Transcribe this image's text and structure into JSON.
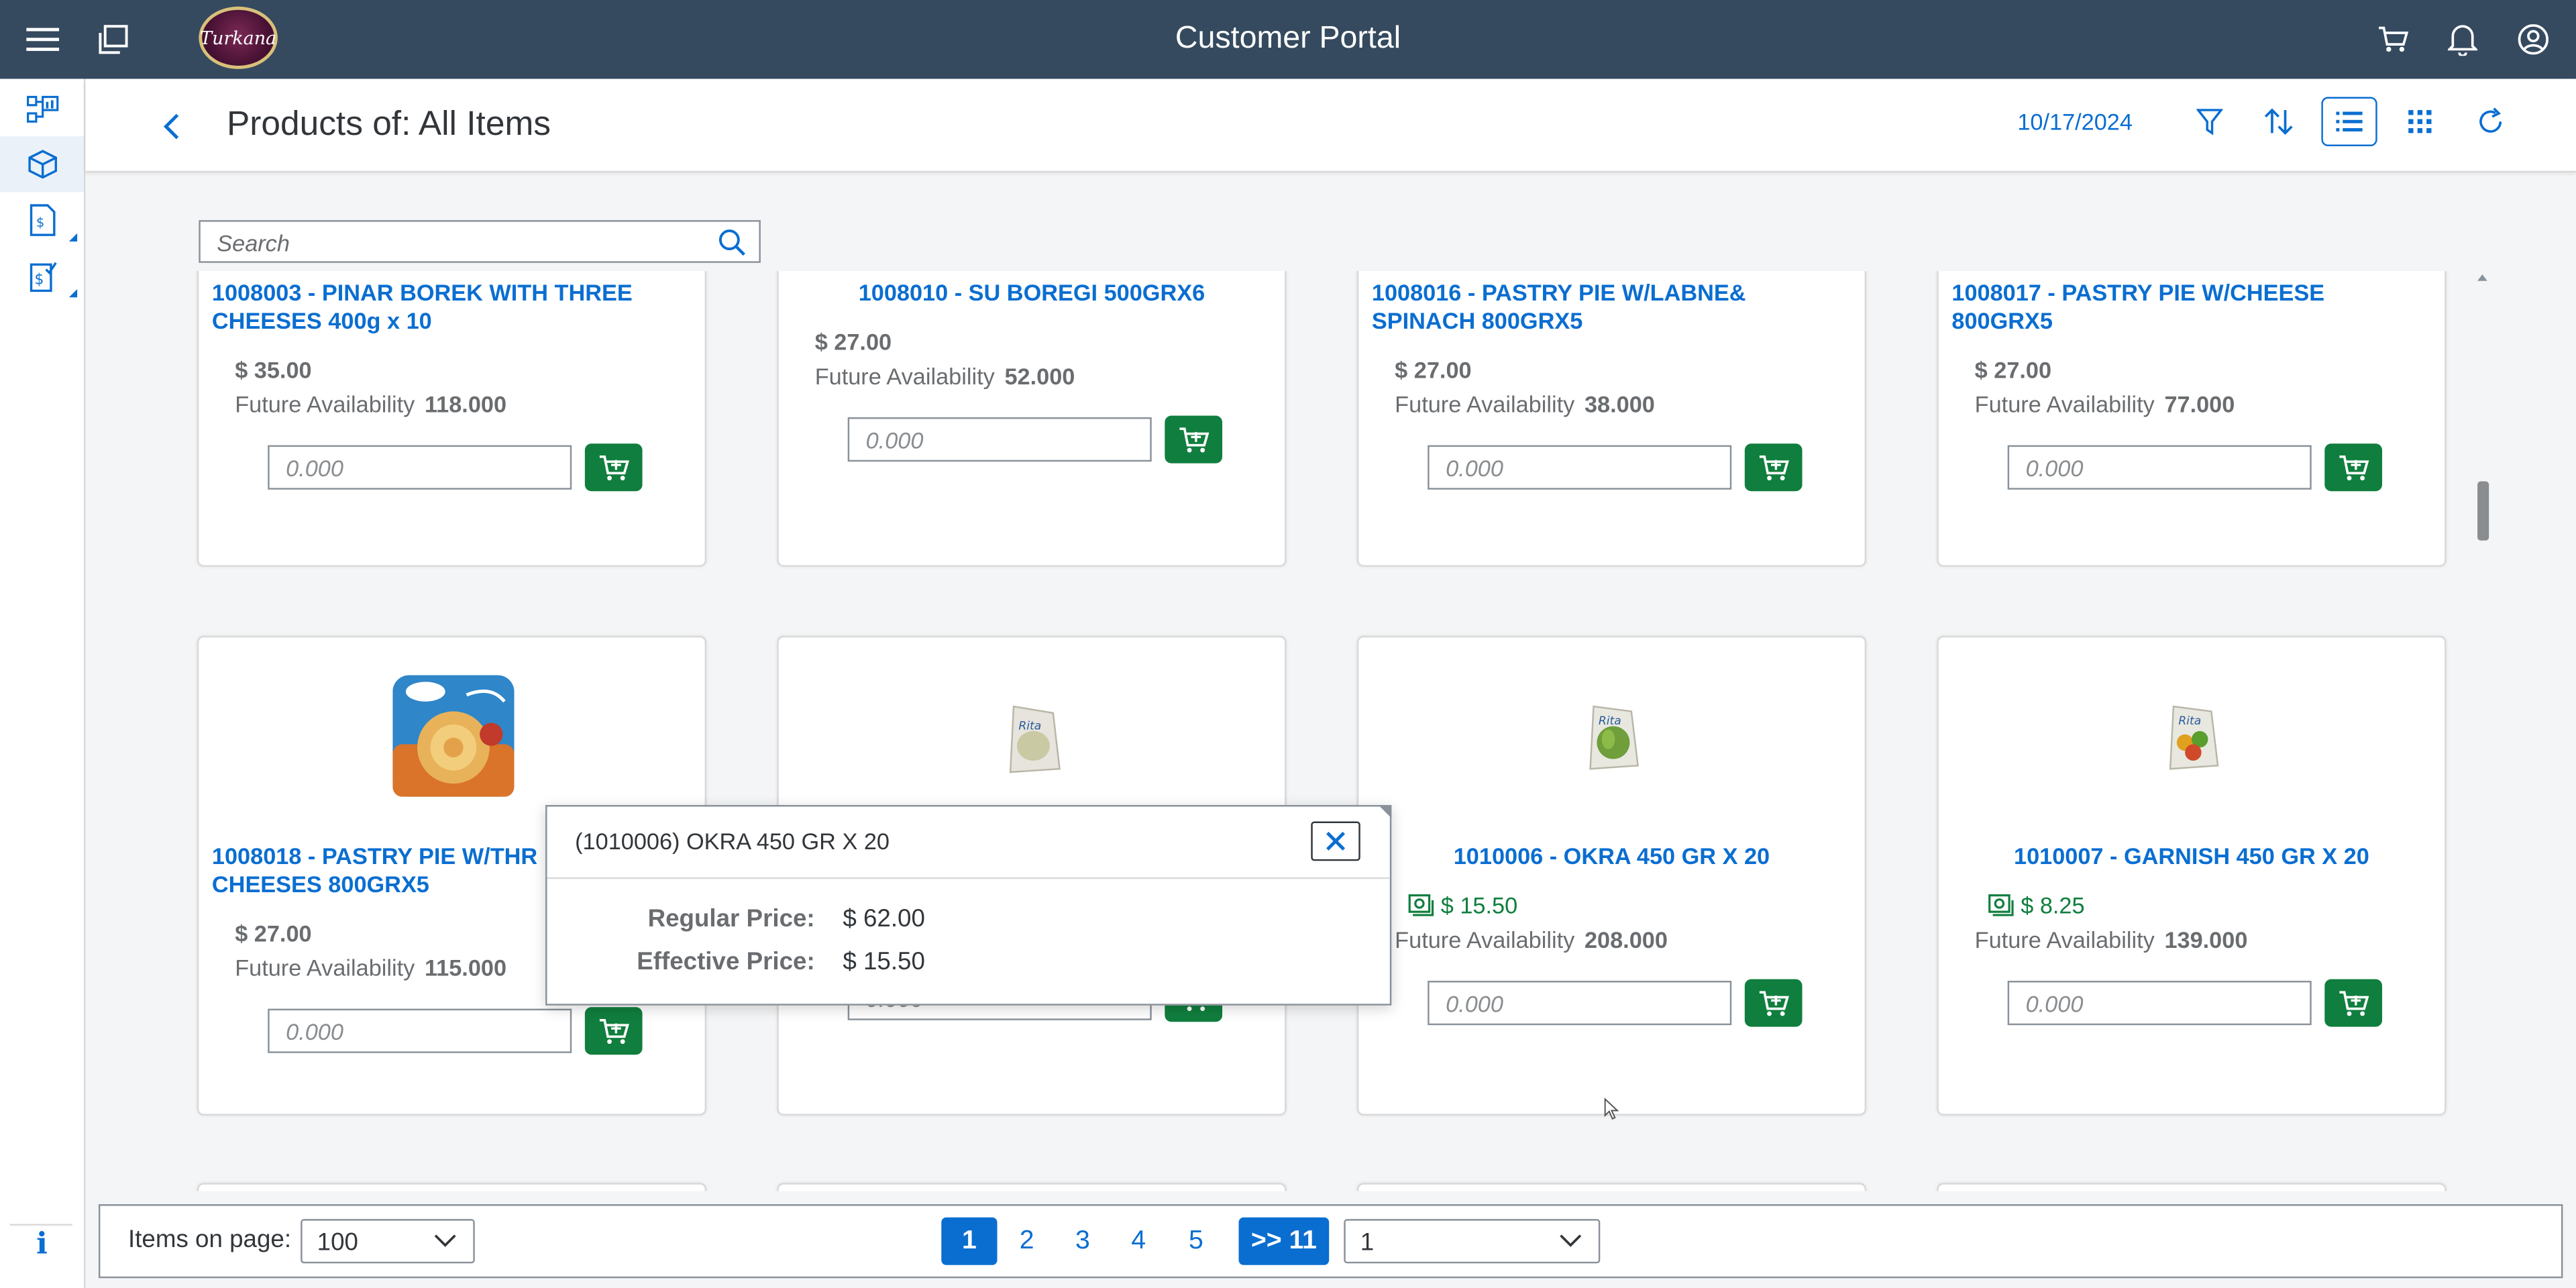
{
  "shell": {
    "title": "Customer Portal",
    "logo_text": "Turkana"
  },
  "header": {
    "title": "Products of: All Items",
    "date": "10/17/2024"
  },
  "search": {
    "placeholder": "Search"
  },
  "products": [
    {
      "title": "1008003 - PINAR BOREK WITH THREE CHEESES 400g x 10",
      "price": "$ 35.00",
      "avail_label": "Future Availability",
      "avail_value": "118.000",
      "qty_placeholder": "0.000"
    },
    {
      "title": "1008010 - SU BOREGI 500GRX6",
      "price": "$ 27.00",
      "avail_label": "Future Availability",
      "avail_value": "52.000",
      "qty_placeholder": "0.000"
    },
    {
      "title": "1008016 - PASTRY PIE W/LABNE& SPINACH 800GRX5",
      "price": "$ 27.00",
      "avail_label": "Future Availability",
      "avail_value": "38.000",
      "qty_placeholder": "0.000"
    },
    {
      "title": "1008017 - PASTRY PIE W/CHEESE 800GRX5",
      "price": "$ 27.00",
      "avail_label": "Future Availability",
      "avail_value": "77.000",
      "qty_placeholder": "0.000"
    },
    {
      "title": "1008018 - PASTRY PIE W/THREE CHEESES 800GRX5",
      "title_line1": "1008018 - PASTRY PIE W/THR",
      "title_line2": "CHEESES 800GRX5",
      "price": "$ 27.00",
      "avail_label": "Future Availability",
      "avail_value": "115.000",
      "qty_placeholder": "0.000"
    },
    {
      "title": "",
      "price": "",
      "avail_label": "",
      "avail_value": "",
      "qty_placeholder": "0.000"
    },
    {
      "title": "1010006 - OKRA 450 GR X 20",
      "price": "$ 15.50",
      "avail_label": "Future Availability",
      "avail_value": "208.000",
      "qty_placeholder": "0.000"
    },
    {
      "title": "1010007 - GARNISH 450 GR X 20",
      "price": "$ 8.25",
      "avail_label": "Future Availability",
      "avail_value": "139.000",
      "qty_placeholder": "0.000"
    }
  ],
  "popover": {
    "title": "(1010006) OKRA 450 GR X 20",
    "regular_label": "Regular Price:",
    "regular_value": "$ 62.00",
    "effective_label": "Effective Price:",
    "effective_value": "$ 15.50"
  },
  "footer": {
    "items_label": "Items on page:",
    "items_value": "100",
    "pages": [
      "1",
      "2",
      "3",
      "4",
      "5"
    ],
    "next_label": ">> 11",
    "page_select": "1"
  },
  "nav": {
    "info_label": "i"
  },
  "colors": {
    "shell": "#354a5f",
    "link": "#0a6ed1",
    "cart_button": "#107e3e",
    "promo_price": "#107e3e"
  },
  "icons": [
    "menu-icon",
    "windows-icon",
    "cart-icon",
    "bell-icon",
    "user-icon",
    "back-icon",
    "filter-icon",
    "sort-icon",
    "list-view-icon",
    "grid-view-icon",
    "refresh-icon",
    "search-icon",
    "add-to-cart-icon",
    "promotion-icon",
    "close-icon",
    "chevron-down-icon"
  ]
}
